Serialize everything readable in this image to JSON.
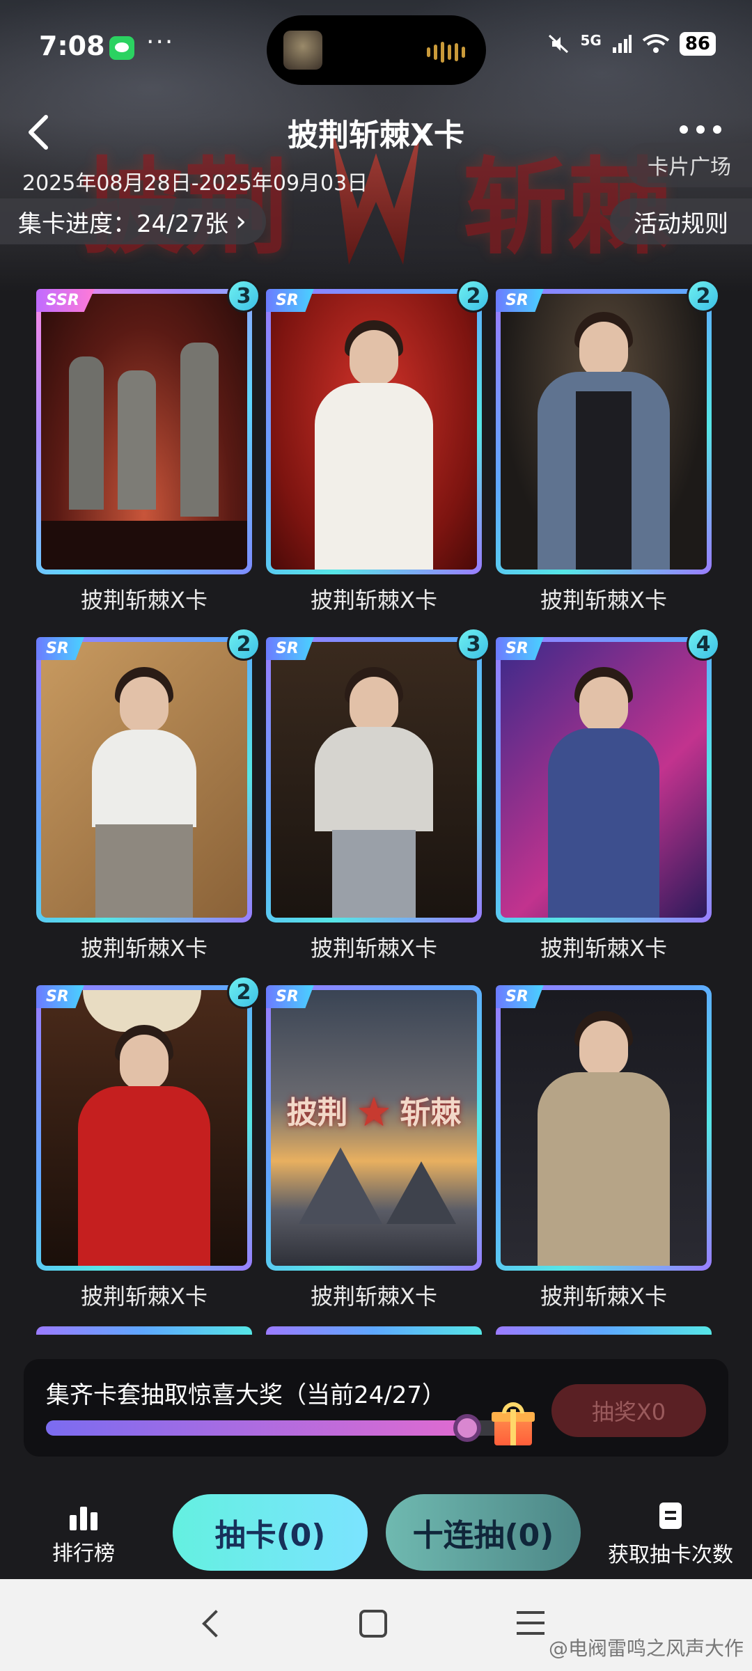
{
  "status_bar": {
    "time": "7:08",
    "dots": "···",
    "network": "5G",
    "battery": "86"
  },
  "header": {
    "title": "披荆斩棘X卡",
    "date_range": "2025年08月28日-2025年09月03日",
    "card_plaza": "卡片广场",
    "progress_label": "集卡进度：24/27张",
    "progress_arrow": "›",
    "rules": "活动规则"
  },
  "hero": {
    "title_left": "披荆",
    "title_right": "斩棘"
  },
  "cards": [
    {
      "rarity": "SSR",
      "count": "3",
      "label": "披荆斩棘X卡"
    },
    {
      "rarity": "SR",
      "count": "2",
      "label": "披荆斩棘X卡"
    },
    {
      "rarity": "SR",
      "count": "2",
      "label": "披荆斩棘X卡"
    },
    {
      "rarity": "SR",
      "count": "2",
      "label": "披荆斩棘X卡"
    },
    {
      "rarity": "SR",
      "count": "3",
      "label": "披荆斩棘X卡"
    },
    {
      "rarity": "SR",
      "count": "4",
      "label": "披荆斩棘X卡"
    },
    {
      "rarity": "SR",
      "count": "2",
      "label": "披荆斩棘X卡"
    },
    {
      "rarity": "SR",
      "count": "",
      "label": "披荆斩棘X卡"
    },
    {
      "rarity": "SR",
      "count": "",
      "label": "披荆斩棘X卡"
    }
  ],
  "card9_logo": {
    "left": "披荆",
    "right": "斩棘"
  },
  "lottery": {
    "text": "集齐卡套抽取惊喜大奖（当前24/27）",
    "progress": 0.889,
    "button": "抽奖X0"
  },
  "actions": {
    "rank": "排行榜",
    "draw": "抽卡(0)",
    "ten_draw": "十连抽(0)",
    "get_draws": "获取抽卡次数"
  },
  "system_nav": {
    "watermark": "@电阀雷鸣之风声大作"
  },
  "colors": {
    "background": "#1b1b1e",
    "draw_button": "#64f0e0",
    "ten_draw_button": "#5c9e99",
    "lottery_button": "#5a2024",
    "card_frame_sr": "#5ea8ff",
    "card_frame_ssr": "#ff8ae6"
  }
}
